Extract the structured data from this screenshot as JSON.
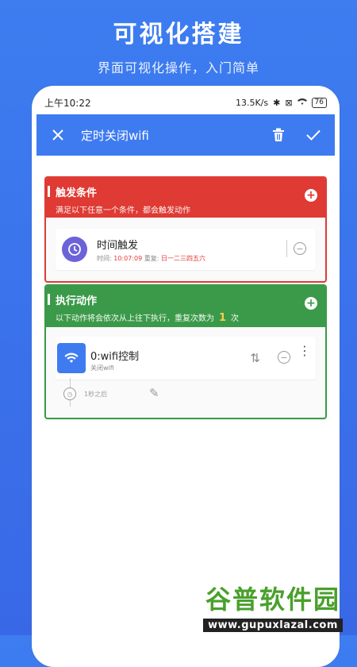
{
  "promo": {
    "title": "可视化搭建",
    "subtitle": "界面可视化操作，入门简单"
  },
  "statusbar": {
    "time": "上午10:22",
    "speed": "13.5K/s",
    "battery": "76"
  },
  "appbar": {
    "title": "定时关闭wifi"
  },
  "trigger_card": {
    "title": "触发条件",
    "subtitle": "满足以下任意一个条件，都会触发动作",
    "item": {
      "title": "时间触发",
      "meta_prefix": "时间:",
      "time": "10:07:09",
      "repeat_prefix": "重复:",
      "repeat": "日一二三四五六"
    }
  },
  "action_card": {
    "title": "执行动作",
    "subtitle_prefix": "以下动作将会依次从上往下执行，重复次数为",
    "repeat_count": "1",
    "subtitle_suffix": "次",
    "item": {
      "title": "0:wifi控制",
      "meta": "关闭wifi"
    },
    "delay_text": "1秒之后"
  },
  "watermark": {
    "logo": "谷普软件园",
    "url": "www.gupuxlazal.com"
  },
  "colors": {
    "primary": "#3e7bf1",
    "trigger_red": "#df3a33",
    "action_green": "#3b9a49"
  }
}
